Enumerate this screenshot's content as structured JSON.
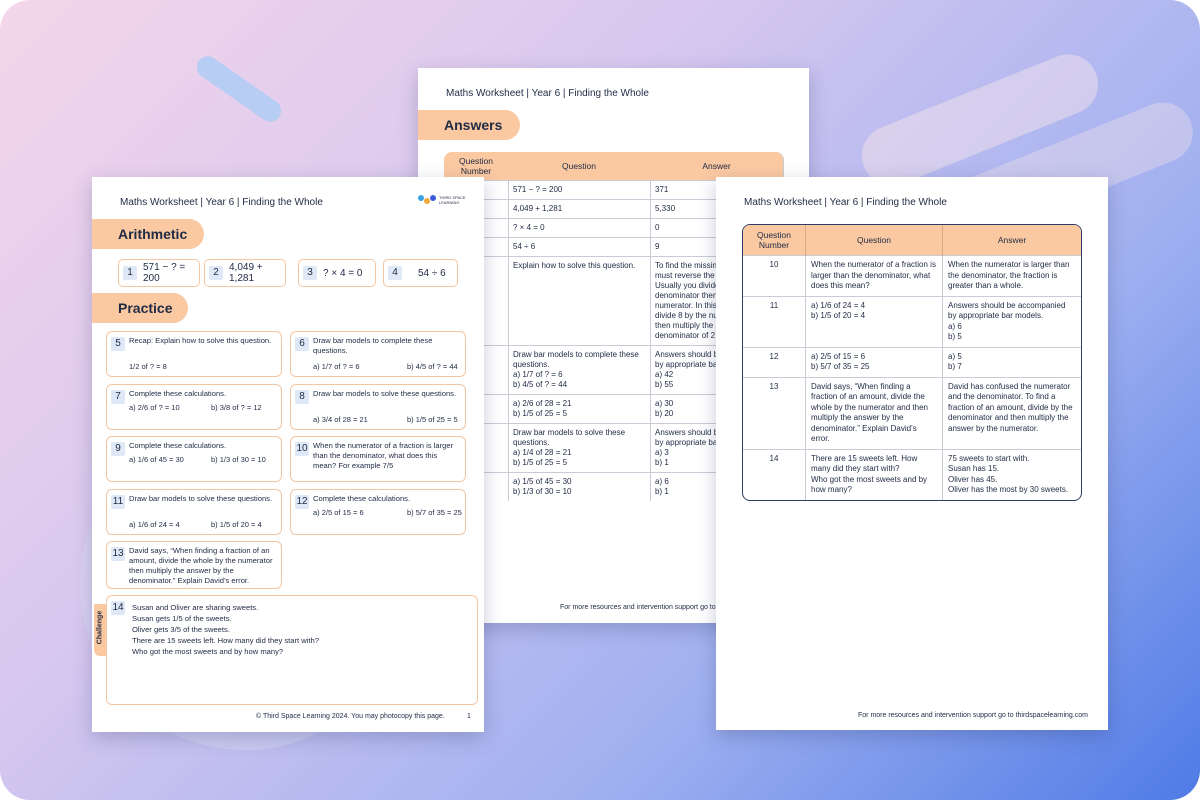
{
  "worksheet_title": "Maths Worksheet | Year 6 | Finding the Whole",
  "back_page": {
    "section_title": "Answers",
    "headers": [
      "Question Number",
      "Question",
      "Answer"
    ],
    "rows": [
      {
        "num": "",
        "q": "571 − ? = 200",
        "a": "371"
      },
      {
        "num": "",
        "q": "4,049 + 1,281",
        "a": "5,330"
      },
      {
        "num": "",
        "q": "? × 4 = 0",
        "a": "0"
      },
      {
        "num": "",
        "q": "54 ÷ 6",
        "a": "9"
      },
      {
        "num": "",
        "q": "Explain how to solve this question.",
        "a": "To find the missin\nmust reverse the o\nUsually you divide\ndenominator then\nnumerator. In this\ndivide 8 by the nu\nthen multiply the\ndenominator of 2"
      },
      {
        "num": "",
        "q": "Draw bar models to complete these questions.\na) 1/7 of ? = 6\nb) 4/5 of ? = 44",
        "a": "Answers should b\nby appropriate ba\na) 42\nb) 55"
      },
      {
        "num": "",
        "q": "a) 2/6 of 28 = 21\nb) 1/5 of 25 = 5",
        "a": "a) 30\nb) 20"
      },
      {
        "num": "",
        "q": "Draw bar models to solve these questions.\na) 1/4 of 28 = 21\nb) 1/5 of 25 = 5",
        "a": "Answers should b\nby appropriate ba\na) 3\nb) 1"
      },
      {
        "num": "",
        "q": "a) 1/5 of 45 = 30\nb) 1/3 of 30 = 10",
        "a": "a) 6\nb) 1"
      }
    ],
    "footer": "For more resources and intervention support go to"
  },
  "right_page": {
    "headers": [
      "Question Number",
      "Question",
      "Answer"
    ],
    "rows": [
      {
        "num": "10",
        "q": "When the numerator of a fraction is larger than the denominator, what does this mean?",
        "a": "When the numerator is larger than the denominator, the fraction is greater than a whole."
      },
      {
        "num": "11",
        "q": "a) 1/6 of 24 = 4\nb) 1/5 of 20 = 4",
        "a": "Answers should be accompanied by appropriate bar models.\na) 6\nb) 5"
      },
      {
        "num": "12",
        "q": "a) 2/5 of 15 = 6\nb) 5/7 of 35 = 25",
        "a": "a) 5\nb) 7"
      },
      {
        "num": "13",
        "q": "David says, “When finding a fraction of an amount, divide the whole by the numerator and then multiply the answer by the denominator.” Explain David’s error.",
        "a": "David has confused the numerator and the denominator. To find a fraction of an amount, divide by the denominator and then multiply the answer by the numerator."
      },
      {
        "num": "14",
        "q": "There are 15 sweets left. How many did they start with?\nWho got the most sweets and by how many?",
        "a": "75 sweets to start with.\nSusan has 15.\nOliver has 45.\nOliver has the most by 30 sweets."
      }
    ],
    "footer": "For more resources and intervention support go to thirdspacelearning.com"
  },
  "front_page": {
    "logo_text": "THIRD SPACE LEARNING",
    "arithmetic_title": "Arithmetic",
    "practice_title": "Practice",
    "arithmetic": [
      {
        "num": "1",
        "text": "571 − ? = 200"
      },
      {
        "num": "2",
        "text": "4,049 + 1,281"
      },
      {
        "num": "3",
        "text": "? × 4 = 0"
      },
      {
        "num": "4",
        "text": "54 ÷ 6"
      }
    ],
    "q5": {
      "num": "5",
      "text": "Recap: Explain how to solve this question.",
      "a": "1/2 of ? = 8"
    },
    "q6": {
      "num": "6",
      "text": "Draw bar models to complete these questions.",
      "a": "a) 1/7 of ? = 6",
      "b": "b) 4/5 of ? = 44"
    },
    "q7": {
      "num": "7",
      "text": "Complete these calculations.",
      "a": "a) 2/6 of ? = 10",
      "b": "b) 3/8 of ? = 12"
    },
    "q8": {
      "num": "8",
      "text": "Draw bar models to solve these questions.",
      "a": "a) 3/4 of 28 = 21",
      "b": "b) 1/5 of 25 = 5"
    },
    "q9": {
      "num": "9",
      "text": "Complete these calculations.",
      "a": "a) 1/6 of 45 = 30",
      "b": "b) 1/3 of 30 = 10"
    },
    "q10": {
      "num": "10",
      "text": "When the numerator of a fraction is larger than the denominator, what does this mean? For example 7/5"
    },
    "q11": {
      "num": "11",
      "text": "Draw bar models to solve these questions.",
      "a": "a) 1/6 of 24 = 4",
      "b": "b) 1/5 of 20 = 4"
    },
    "q12": {
      "num": "12",
      "text": "Complete these calculations.",
      "a": "a) 2/5 of 15 = 6",
      "b": "b) 5/7 of 35 = 25"
    },
    "q13": {
      "num": "13",
      "text": "David says, “When finding a fraction of an amount, divide the whole by the numerator then multiply the answer by the denominator.” Explain David’s error."
    },
    "q14": {
      "num": "14",
      "lines": [
        "Susan and Oliver are sharing sweets.",
        "Susan gets 1/5 of the sweets.",
        "Oliver gets 3/5 of the sweets.",
        "There are 15 sweets left. How many did they start with?",
        "Who got the most sweets and by how many?"
      ]
    },
    "challenge_label": "Challenge",
    "footer": "© Third Space Learning 2024. You may photocopy this page.",
    "page_number": "1"
  },
  "colors": {
    "accent": "#fbc9a1",
    "navy": "#1f2a44",
    "number_bg": "#dfe8f6"
  }
}
